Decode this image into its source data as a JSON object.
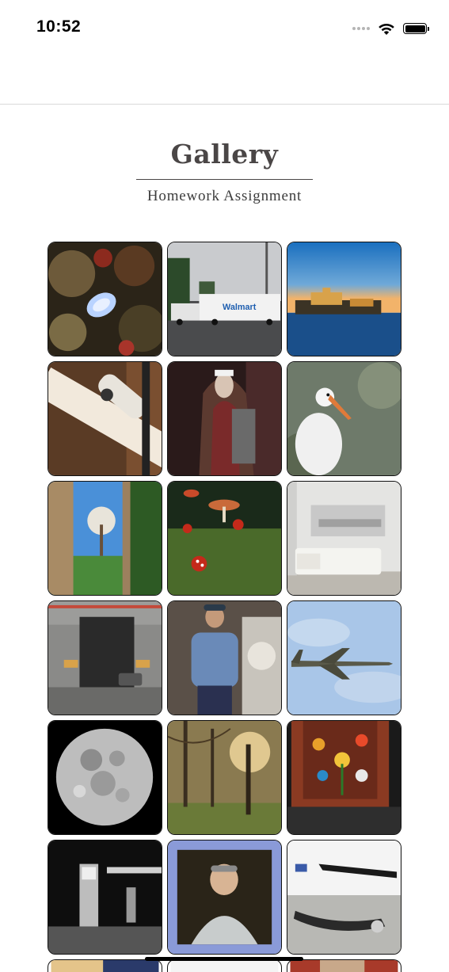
{
  "status_bar": {
    "time": "10:52"
  },
  "gallery": {
    "title": "Gallery",
    "subtitle": "Homework Assignment",
    "photos": [
      {
        "id": "sea-slug",
        "truck_text": ""
      },
      {
        "id": "walmart-truck",
        "truck_text": "Walmart"
      },
      {
        "id": "castle-waterfront"
      },
      {
        "id": "bike-bottle"
      },
      {
        "id": "nun-costume"
      },
      {
        "id": "stork"
      },
      {
        "id": "stone-gate-tree"
      },
      {
        "id": "mushrooms"
      },
      {
        "id": "murphy-bed"
      },
      {
        "id": "parking-garage"
      },
      {
        "id": "man-sweater"
      },
      {
        "id": "fighter-jet"
      },
      {
        "id": "full-moon"
      },
      {
        "id": "forest-sunset"
      },
      {
        "id": "flower-painting"
      },
      {
        "id": "gas-station"
      },
      {
        "id": "portrait-painting"
      },
      {
        "id": "car-parts"
      },
      {
        "id": "partial-row-1"
      },
      {
        "id": "partial-row-2"
      },
      {
        "id": "partial-row-3"
      }
    ]
  }
}
